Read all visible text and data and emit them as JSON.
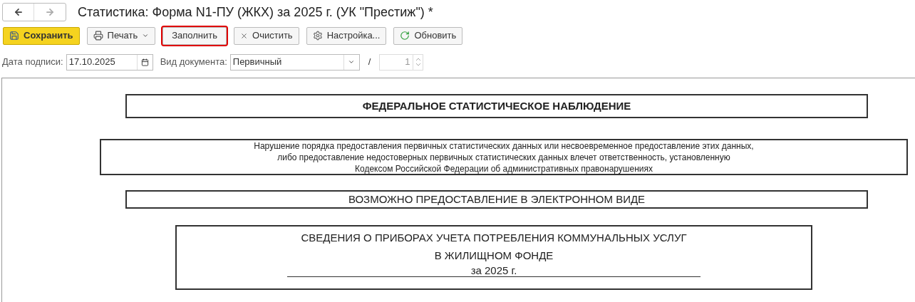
{
  "window": {
    "title": "Статистика: Форма N1-ПУ (ЖКХ) за 2025 г. (УК \"Престиж\") *"
  },
  "toolbar": [
    {
      "label": "Сохранить",
      "kind": "primary",
      "highlighted": false
    },
    {
      "label": "Печать",
      "kind": "dropdown",
      "highlighted": false
    },
    {
      "label": "Заполнить",
      "kind": "plain",
      "highlighted": true
    },
    {
      "label": "Очистить",
      "kind": "clear",
      "highlighted": false
    },
    {
      "label": "Настройка...",
      "kind": "settings",
      "highlighted": false
    },
    {
      "label": "Обновить",
      "kind": "refresh",
      "highlighted": false
    }
  ],
  "fields": {
    "signature_date": {
      "label": "Дата подписи:",
      "value": "17.10.2025"
    },
    "document_type": {
      "label": "Вид документа:",
      "value": "Первичный"
    },
    "separator": "/",
    "number": {
      "value": "1",
      "disabled": true
    }
  },
  "document": {
    "header": "ФЕДЕРАЛЬНОЕ СТАТИСТИЧЕСКОЕ НАБЛЮДЕНИЕ",
    "warning": [
      "Нарушение порядка предоставления первичных статистических данных или несвоевременное предоставление этих данных,",
      "либо предоставление недостоверных первичных статистических данных влечет ответственность, установленную",
      "Кодексом Российской Федерации об административных правонарушениях"
    ],
    "electronic": "ВОЗМОЖНО ПРЕДОСТАВЛЕНИЕ В ЭЛЕКТРОННОМ ВИДЕ",
    "title_lines": [
      "СВЕДЕНИЯ О ПРИБОРАХ УЧЕТА ПОТРЕБЛЕНИЯ КОММУНАЛЬНЫХ УСЛУГ",
      "В ЖИЛИЩНОМ ФОНДЕ"
    ],
    "period": "за 2025 г."
  }
}
